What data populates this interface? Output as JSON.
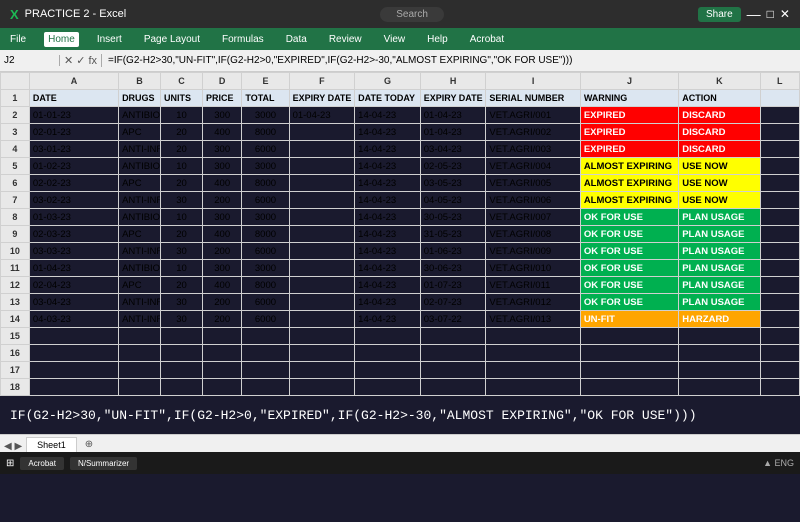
{
  "titlebar": {
    "title": "PRACTICE 2 - Excel",
    "search_placeholder": "Search",
    "share_label": "Share"
  },
  "ribbon": {
    "tabs": [
      "File",
      "Home",
      "Insert",
      "Page Layout",
      "Formulas",
      "Data",
      "Review",
      "View",
      "Help",
      "Acrobat"
    ]
  },
  "formula_bar": {
    "name_box": "J2",
    "formula": "=IF(G2-H2>30,\"UN-FIT\",IF(G2-H2>0,\"EXPIRED\",IF(G2-H2>-30,\"ALMOST EXPIRING\",\"OK FOR USE\")))"
  },
  "columns": [
    "A",
    "B",
    "C",
    "D",
    "E",
    "F",
    "G",
    "H",
    "I",
    "J",
    "K",
    "L"
  ],
  "headers": {
    "A": "DATE",
    "B": "DRUGS",
    "C": "UNITS",
    "D": "PRICE",
    "E": "TOTAL",
    "F": "EXPIRY DATE",
    "G": "DATE TODAY",
    "H": "EXPIRY DATE",
    "I": "SERIAL NUMBER",
    "J": "WARNING",
    "K": "ACTION",
    "L": ""
  },
  "rows": [
    {
      "num": 2,
      "A": "01-01-23",
      "B": "ANTIBIOTICS",
      "C": "10",
      "D": "300",
      "E": "3000",
      "F": "01-04-23",
      "G": "14-04-23",
      "H": "01-04-23",
      "I": "VET.AGRI/001",
      "J": "EXPIRED",
      "J_class": "status-expired",
      "K": "DISCARD",
      "K_class": "action-discard"
    },
    {
      "num": 3,
      "A": "02-01-23",
      "B": "APC",
      "C": "20",
      "D": "400",
      "E": "8000",
      "F": "",
      "G": "14-04-23",
      "H": "01-04-23",
      "I": "VET.AGRI/002",
      "J": "EXPIRED",
      "J_class": "status-expired",
      "K": "DISCARD",
      "K_class": "action-discard"
    },
    {
      "num": 4,
      "A": "03-01-23",
      "B": "ANTI-INFLAMATORY",
      "C": "20",
      "D": "300",
      "E": "6000",
      "F": "",
      "G": "14-04-23",
      "H": "03-04-23",
      "I": "VET.AGRI/003",
      "J": "EXPIRED",
      "J_class": "status-expired",
      "K": "DISCARD",
      "K_class": "action-discard"
    },
    {
      "num": 5,
      "A": "01-02-23",
      "B": "ANTIBIOTICS",
      "C": "10",
      "D": "300",
      "E": "3000",
      "F": "",
      "G": "14-04-23",
      "H": "02-05-23",
      "I": "VET.AGRI/004",
      "J": "ALMOST EXPIRING",
      "J_class": "status-almost",
      "K": "USE NOW",
      "K_class": "action-usenow"
    },
    {
      "num": 6,
      "A": "02-02-23",
      "B": "APC",
      "C": "20",
      "D": "400",
      "E": "8000",
      "F": "",
      "G": "14-04-23",
      "H": "03-05-23",
      "I": "VET.AGRI/005",
      "J": "ALMOST EXPIRING",
      "J_class": "status-almost",
      "K": "USE NOW",
      "K_class": "action-usenow"
    },
    {
      "num": 7,
      "A": "03-02-23",
      "B": "ANTI-INFLAMATORY",
      "C": "30",
      "D": "200",
      "E": "6000",
      "F": "",
      "G": "14-04-23",
      "H": "04-05-23",
      "I": "VET.AGRI/006",
      "J": "ALMOST EXPIRING",
      "J_class": "status-almost",
      "K": "USE NOW",
      "K_class": "action-usenow"
    },
    {
      "num": 8,
      "A": "01-03-23",
      "B": "ANTIBIOTICS",
      "C": "10",
      "D": "300",
      "E": "3000",
      "F": "",
      "G": "14-04-23",
      "H": "30-05-23",
      "I": "VET.AGRI/007",
      "J": "OK FOR USE",
      "J_class": "status-ok",
      "K": "PLAN USAGE",
      "K_class": "action-plan"
    },
    {
      "num": 9,
      "A": "02-03-23",
      "B": "APC",
      "C": "20",
      "D": "400",
      "E": "8000",
      "F": "",
      "G": "14-04-23",
      "H": "31-05-23",
      "I": "VET.AGRI/008",
      "J": "OK FOR USE",
      "J_class": "status-ok",
      "K": "PLAN USAGE",
      "K_class": "action-plan"
    },
    {
      "num": 10,
      "A": "03-03-23",
      "B": "ANTI-INFLAMATORY",
      "C": "30",
      "D": "200",
      "E": "6000",
      "F": "",
      "G": "14-04-23",
      "H": "01-06-23",
      "I": "VET.AGRI/009",
      "J": "OK FOR USE",
      "J_class": "status-ok",
      "K": "PLAN USAGE",
      "K_class": "action-plan"
    },
    {
      "num": 11,
      "A": "01-04-23",
      "B": "ANTIBIOTICS",
      "C": "10",
      "D": "300",
      "E": "3000",
      "F": "",
      "G": "14-04-23",
      "H": "30-06-23",
      "I": "VET.AGRI/010",
      "J": "OK FOR USE",
      "J_class": "status-ok",
      "K": "PLAN USAGE",
      "K_class": "action-plan"
    },
    {
      "num": 12,
      "A": "02-04-23",
      "B": "APC",
      "C": "20",
      "D": "400",
      "E": "8000",
      "F": "",
      "G": "14-04-23",
      "H": "01-07-23",
      "I": "VET.AGRI/011",
      "J": "OK FOR USE",
      "J_class": "status-ok",
      "K": "PLAN USAGE",
      "K_class": "action-plan"
    },
    {
      "num": 13,
      "A": "03-04-23",
      "B": "ANTI-INFLAMATORY",
      "C": "30",
      "D": "200",
      "E": "6000",
      "F": "",
      "G": "14-04-23",
      "H": "02-07-23",
      "I": "VET.AGRI/012",
      "J": "OK FOR USE",
      "J_class": "status-ok",
      "K": "PLAN USAGE",
      "K_class": "action-plan"
    },
    {
      "num": 14,
      "A": "04-03-23",
      "B": "ANTI-INFLAMATORY",
      "C": "30",
      "D": "200",
      "E": "6000",
      "F": "",
      "G": "14-04-23",
      "H": "03-07-22",
      "I": "VET.AGRI/013",
      "J": "UN-FIT",
      "J_class": "status-unfit",
      "K": "HARZARD",
      "K_class": "action-hazard"
    }
  ],
  "bottom_formula": "IF(G2-H2>30,\"UN-FIT\",IF(G2-H2>0,\"EXPIRED\",IF(G2-H2>-30,\"ALMOST EXPIRING\",\"OK FOR USE\")))",
  "sheet_tabs": [
    "Sheet1"
  ],
  "taskbar_items": [
    "Acrobat",
    "N/Summarizer"
  ]
}
